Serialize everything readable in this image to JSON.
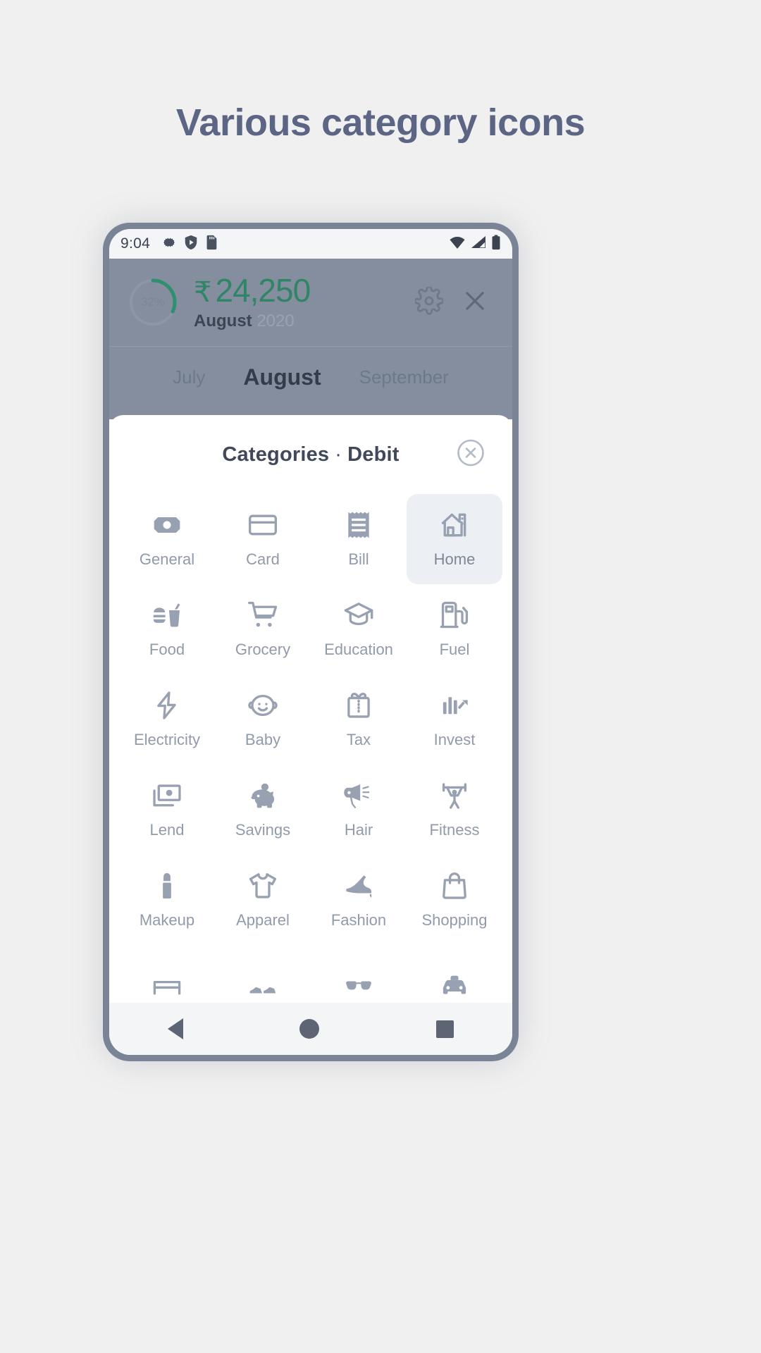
{
  "page": {
    "heading": "Various category icons",
    "heading_color": "#5c6684",
    "background": "#f0f0f0"
  },
  "statusbar": {
    "clock": "9:04",
    "left_icons": [
      "gear-icon",
      "shield-play-icon",
      "sd-card-icon"
    ],
    "right_icons": [
      "wifi-icon",
      "signal-icon",
      "battery-icon"
    ]
  },
  "header": {
    "progress_percent": "32%",
    "progress_value": 32,
    "currency_symbol": "₹",
    "amount": "24,250",
    "amount_color": "#2f8566",
    "month": "August",
    "year": "2020",
    "actions": [
      {
        "name": "settings-button",
        "icon": "gear-icon"
      },
      {
        "name": "close-button",
        "icon": "close-icon"
      }
    ],
    "months": [
      {
        "label": "July",
        "active": false
      },
      {
        "label": "August",
        "active": true
      },
      {
        "label": "September",
        "active": false
      }
    ]
  },
  "sheet": {
    "title_primary": "Categories",
    "title_separator": "·",
    "title_secondary": "Debit",
    "close_icon": "close-circle-icon",
    "selected_category": "Home",
    "categories": [
      {
        "label": "General",
        "icon": "banknote-icon",
        "selected": false
      },
      {
        "label": "Card",
        "icon": "credit-card-icon",
        "selected": false
      },
      {
        "label": "Bill",
        "icon": "receipt-icon",
        "selected": false
      },
      {
        "label": "Home",
        "icon": "house-icon",
        "selected": true
      },
      {
        "label": "Food",
        "icon": "burger-drink-icon",
        "selected": false
      },
      {
        "label": "Grocery",
        "icon": "shopping-cart-icon",
        "selected": false
      },
      {
        "label": "Education",
        "icon": "graduation-cap-icon",
        "selected": false
      },
      {
        "label": "Fuel",
        "icon": "fuel-pump-icon",
        "selected": false
      },
      {
        "label": "Electricity",
        "icon": "lightning-bolt-icon",
        "selected": false
      },
      {
        "label": "Baby",
        "icon": "baby-face-icon",
        "selected": false
      },
      {
        "label": "Tax",
        "icon": "gift-box-icon",
        "selected": false
      },
      {
        "label": "Invest",
        "icon": "bar-chart-icon",
        "selected": false
      },
      {
        "label": "Lend",
        "icon": "cash-stack-icon",
        "selected": false
      },
      {
        "label": "Savings",
        "icon": "piggy-bank-icon",
        "selected": false
      },
      {
        "label": "Hair",
        "icon": "hair-dryer-icon",
        "selected": false
      },
      {
        "label": "Fitness",
        "icon": "weightlifter-icon",
        "selected": false
      },
      {
        "label": "Makeup",
        "icon": "lipstick-icon",
        "selected": false
      },
      {
        "label": "Apparel",
        "icon": "tshirt-icon",
        "selected": false
      },
      {
        "label": "Fashion",
        "icon": "high-heel-icon",
        "selected": false
      },
      {
        "label": "Shopping",
        "icon": "shopping-bag-icon",
        "selected": false
      },
      {
        "label": "",
        "icon": "bed-icon",
        "selected": false
      },
      {
        "label": "",
        "icon": "shoes-icon",
        "selected": false
      },
      {
        "label": "",
        "icon": "sunglasses-icon",
        "selected": false
      },
      {
        "label": "",
        "icon": "car-icon",
        "selected": false
      }
    ]
  },
  "navbar": {
    "buttons": [
      {
        "name": "nav-back-button",
        "icon": "triangle-back-icon"
      },
      {
        "name": "nav-home-button",
        "icon": "circle-home-icon"
      },
      {
        "name": "nav-recent-button",
        "icon": "square-recents-icon"
      }
    ]
  },
  "colors": {
    "icon": "#98a1b2",
    "header_dim": "#858e9f",
    "selected_tile": "#eceff3"
  }
}
